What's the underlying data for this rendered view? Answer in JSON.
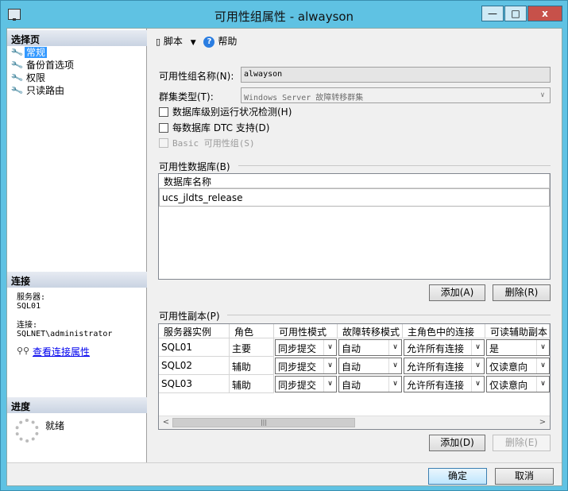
{
  "window": {
    "title": "可用性组属性 - alwayson",
    "minimize": "—",
    "maximize": "□",
    "close": "x"
  },
  "left": {
    "select_page_header": "选择页",
    "nav": [
      {
        "label": "常规",
        "icon": "wrench-icon"
      },
      {
        "label": "备份首选项",
        "icon": "wrench-icon"
      },
      {
        "label": "权限",
        "icon": "wrench-icon"
      },
      {
        "label": "只读路由",
        "icon": "wrench-icon"
      }
    ],
    "connection_header": "连接",
    "server_label": "服务器:",
    "server_value": "SQL01",
    "connection_label": "连接:",
    "connection_value": "SQLNET\\administrator",
    "view_connection_link": "查看连接属性",
    "progress_header": "进度",
    "progress_status": "就绪"
  },
  "toolbar": {
    "script_label": "脚本",
    "help_label": "帮助"
  },
  "form": {
    "ag_name_label": "可用性组名称(N):",
    "ag_name_value": "alwayson",
    "cluster_type_label": "群集类型(T):",
    "cluster_type_value": "Windows Server 故障转移群集",
    "db_health_check": "数据库级别运行状况检测(H)",
    "per_db_dtc": "每数据库 DTC 支持(D)",
    "basic_ag": "Basic 可用性组(S)"
  },
  "databases": {
    "section_label": "可用性数据库(B)",
    "column": "数据库名称",
    "rows": [
      "ucs_jldts_release"
    ],
    "add_button": "添加(A)",
    "remove_button": "删除(R)"
  },
  "replicas": {
    "section_label": "可用性副本(P)",
    "columns": [
      "服务器实例",
      "角色",
      "可用性模式",
      "故障转移模式",
      "主角色中的连接",
      "可读辅助副本"
    ],
    "rows": [
      {
        "server": "SQL01",
        "role": "主要",
        "availability": "同步提交",
        "failover": "自动",
        "primary_conn": "允许所有连接",
        "readable": "是"
      },
      {
        "server": "SQL02",
        "role": "辅助",
        "availability": "同步提交",
        "failover": "自动",
        "primary_conn": "允许所有连接",
        "readable": "仅读意向"
      },
      {
        "server": "SQL03",
        "role": "辅助",
        "availability": "同步提交",
        "failover": "自动",
        "primary_conn": "允许所有连接",
        "readable": "仅读意向"
      }
    ],
    "add_button": "添加(D)",
    "remove_button": "删除(E)"
  },
  "footer": {
    "ok_button": "确定",
    "cancel_button": "取消"
  }
}
